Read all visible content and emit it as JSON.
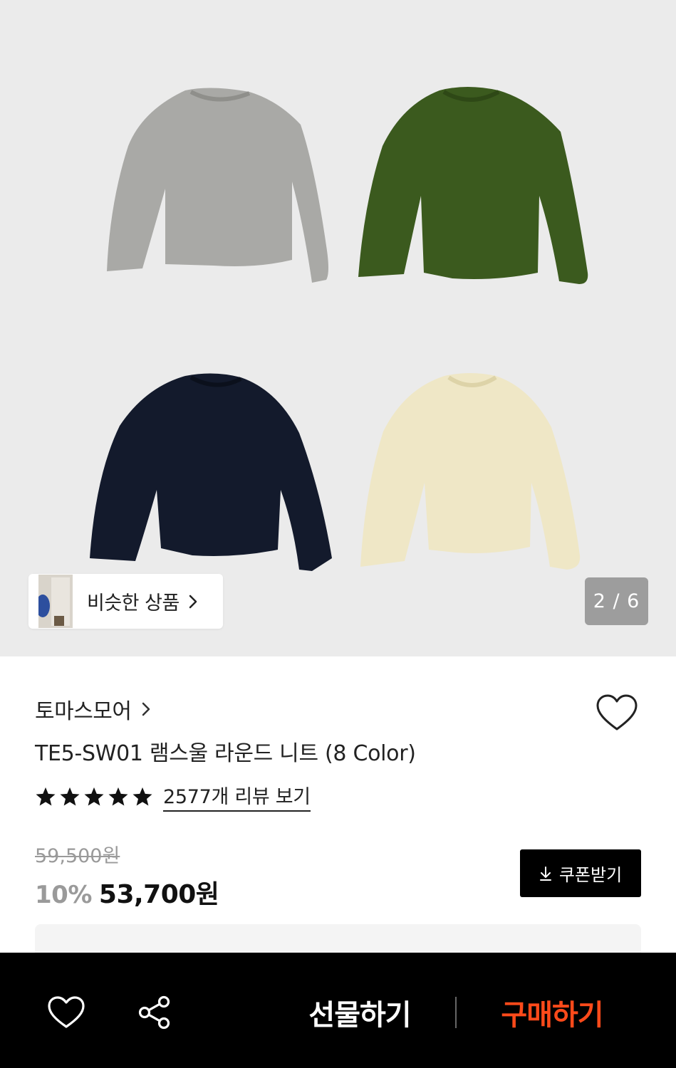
{
  "gallery": {
    "similar_products_label": "비슷한 상품",
    "page_counter": "2 / 6",
    "sweater_colors": [
      "#a9a9a6",
      "#3b5a1e",
      "#131a2c",
      "#efe7c6"
    ]
  },
  "product": {
    "brand": "토마스모어",
    "title": "TE5-SW01 램스울 라운드 니트 (8 Color)",
    "rating_stars": 5,
    "review_link": "2577개 리뷰 보기",
    "original_price": "59,500원",
    "discount": "10%",
    "sale_price": "53,700원",
    "coupon_label": "쿠폰받기"
  },
  "bottom_bar": {
    "gift_label": "선물하기",
    "buy_label": "구매하기",
    "buy_color": "#ff4a1a"
  }
}
